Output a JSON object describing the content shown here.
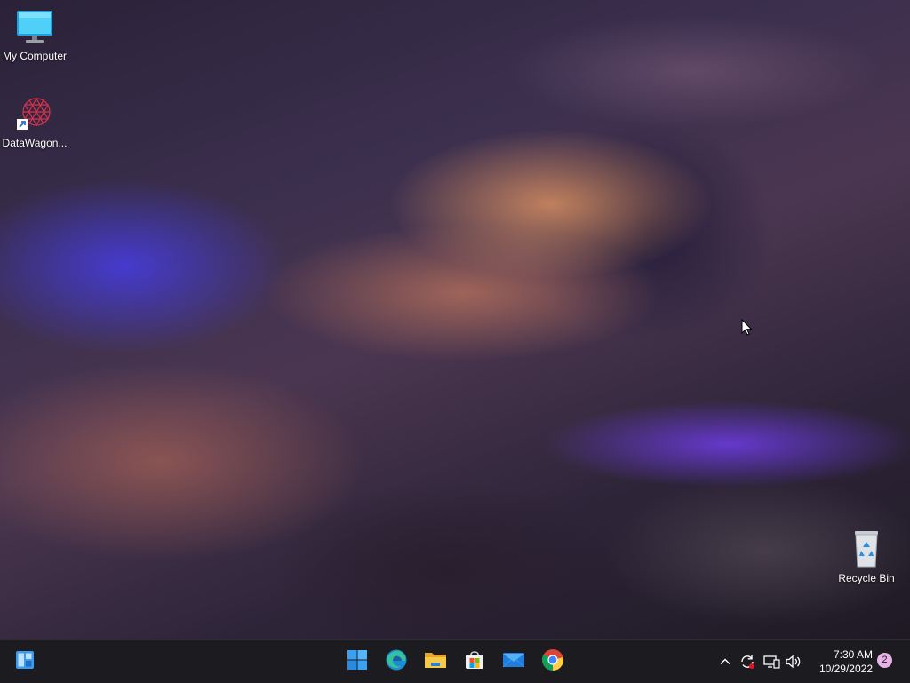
{
  "desktop": {
    "icons": [
      {
        "label": "My Computer",
        "icon": "monitor-icon"
      },
      {
        "label": "DataWagon...",
        "icon": "datawagon-shortcut-icon"
      },
      {
        "label": "Recycle Bin",
        "icon": "recycle-bin-icon"
      }
    ]
  },
  "taskbar": {
    "pinned": [
      {
        "name": "widgets",
        "icon": "widgets-icon"
      },
      {
        "name": "start",
        "icon": "windows-start-icon"
      },
      {
        "name": "edge",
        "icon": "edge-browser-icon"
      },
      {
        "name": "file-explorer",
        "icon": "folder-icon"
      },
      {
        "name": "store",
        "icon": "store-icon"
      },
      {
        "name": "mail",
        "icon": "mail-icon"
      },
      {
        "name": "chrome",
        "icon": "chrome-icon"
      }
    ],
    "tray": {
      "icons": [
        "chevron-up-icon",
        "sync-icon",
        "network-icon",
        "volume-icon"
      ],
      "time": "7:30 AM",
      "date": "10/29/2022",
      "notification_count": "2"
    }
  },
  "colors": {
    "taskbar_bg": "#1c1c20",
    "accent_blue": "#3a9bf0",
    "notification_badge": "#e8b4e8"
  }
}
